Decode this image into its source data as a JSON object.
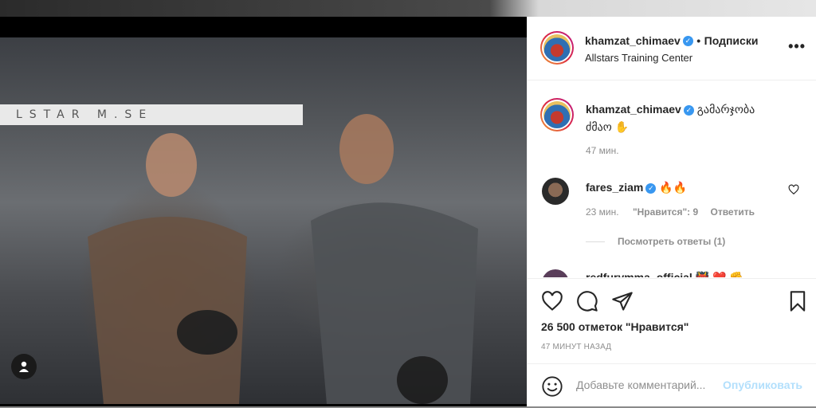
{
  "photo": {
    "banner_text": "LSTAR  M.SE",
    "tag_icon": "user-icon"
  },
  "header": {
    "username": "khamzat_chimaev",
    "verified_icon": "verified-badge-icon",
    "separator": "•",
    "follow_label": "Подписки",
    "location": "Allstars Training Center",
    "more_icon": "more-horizontal-icon"
  },
  "caption": {
    "username": "khamzat_chimaev",
    "text": "გამარჯობა ძმაო ✋",
    "time": "47 мин."
  },
  "comments": [
    {
      "username": "fares_ziam",
      "text": "🔥🔥",
      "time": "23 мин.",
      "likes_label": "\"Нравится\": 9",
      "reply_label": "Ответить",
      "view_replies": "Посмотреть ответы (1)"
    },
    {
      "username": "redfurymma_official",
      "text": "👹 ❤️ ✊"
    }
  ],
  "actions": {
    "like_icon": "heart-icon",
    "comment_icon": "comment-icon",
    "share_icon": "send-icon",
    "save_icon": "bookmark-icon",
    "likes_text": "26 500 отметок \"Нравится\"",
    "timestamp": "47 МИНУТ НАЗАД"
  },
  "composer": {
    "emoji_icon": "smiley-icon",
    "placeholder": "Добавьте комментарий...",
    "publish_label": "Опубликовать"
  }
}
